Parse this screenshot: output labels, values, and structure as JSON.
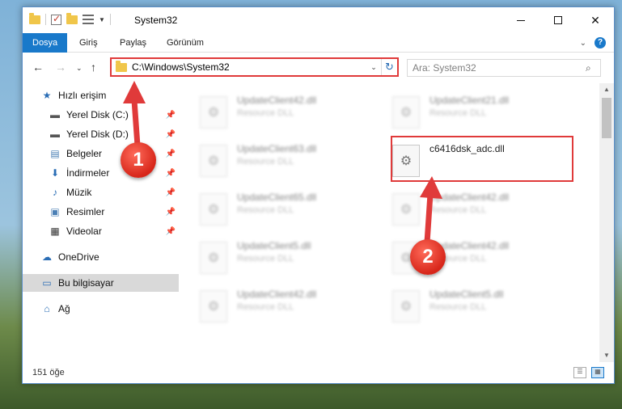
{
  "window": {
    "title": "System32",
    "controls": {
      "minimize": "—",
      "maximize": "☐",
      "close": "✕"
    }
  },
  "ribbon": {
    "tabs": [
      {
        "label": "Dosya",
        "active": true
      },
      {
        "label": "Giriş"
      },
      {
        "label": "Paylaş"
      },
      {
        "label": "Görünüm"
      }
    ],
    "help": "?"
  },
  "address": {
    "path": "C:\\Windows\\System32",
    "search_placeholder": "Ara: System32"
  },
  "sidebar": {
    "items": [
      {
        "label": "Hızlı erişim",
        "icon": "star-icon",
        "pinned": false
      },
      {
        "label": "Yerel Disk (C:)",
        "icon": "drive-icon",
        "pinned": true
      },
      {
        "label": "Yerel Disk (D:)",
        "icon": "drive-icon",
        "pinned": true
      },
      {
        "label": "Belgeler",
        "icon": "document-icon",
        "pinned": true
      },
      {
        "label": "İndirmeler",
        "icon": "download-icon",
        "pinned": true
      },
      {
        "label": "Müzik",
        "icon": "music-icon",
        "pinned": true
      },
      {
        "label": "Resimler",
        "icon": "pictures-icon",
        "pinned": true
      },
      {
        "label": "Videolar",
        "icon": "video-icon",
        "pinned": true
      },
      {
        "label": "OneDrive",
        "icon": "cloud-icon",
        "pinned": false
      },
      {
        "label": "Bu bilgisayar",
        "icon": "computer-icon",
        "pinned": false,
        "selected": true
      },
      {
        "label": "Ağ",
        "icon": "network-icon",
        "pinned": false
      }
    ]
  },
  "files": [
    {
      "name": "UpdateClient42.dll",
      "type": "Resource DLL",
      "blurred": true
    },
    {
      "name": "UpdateClient21.dll",
      "type": "Resource DLL",
      "blurred": true
    },
    {
      "name": "UpdateClient63.dll",
      "type": "Resource DLL",
      "blurred": true
    },
    {
      "name": "c6416dsk_adc.dll",
      "type": "",
      "blurred": false
    },
    {
      "name": "UpdateClient65.dll",
      "type": "Resource DLL",
      "blurred": true
    },
    {
      "name": "UpdateClient42.dll",
      "type": "Resource DLL",
      "blurred": true
    },
    {
      "name": "UpdateClient5.dll",
      "type": "Resource DLL",
      "blurred": true
    },
    {
      "name": "UpdateClient42.dll",
      "type": "Resource DLL",
      "blurred": true
    },
    {
      "name": "UpdateClient42.dll",
      "type": "Resource DLL",
      "blurred": true
    },
    {
      "name": "UpdateClient5.dll",
      "type": "Resource DLL",
      "blurred": true
    }
  ],
  "status": {
    "count": "151 öğe"
  },
  "annotations": {
    "badge1": "1",
    "badge2": "2",
    "color": "#e03a3a"
  }
}
